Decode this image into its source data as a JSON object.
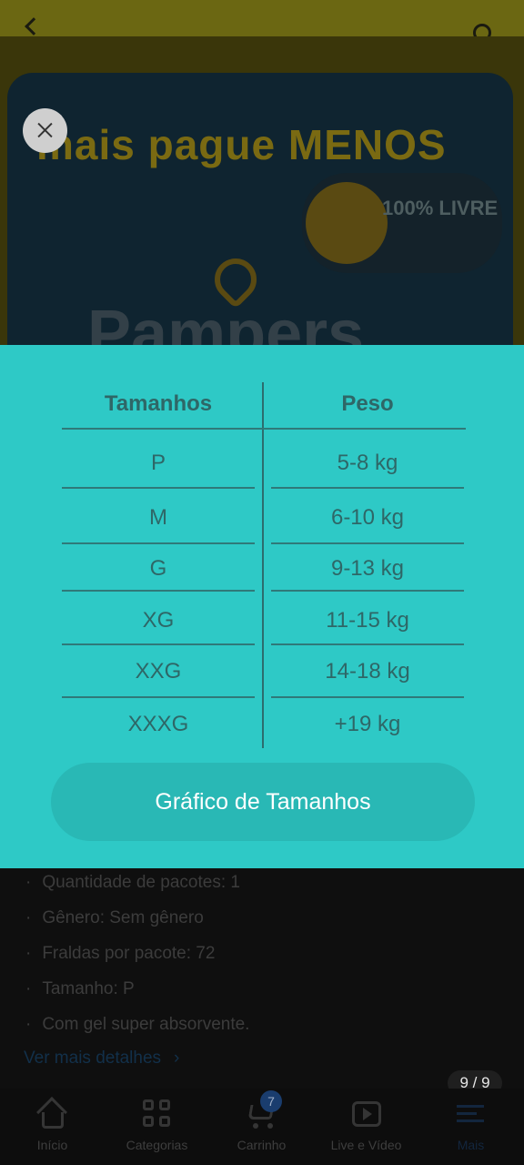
{
  "header": {
    "back_icon": "arrow-left-icon",
    "search_icon": "search-icon"
  },
  "product_image": {
    "banner": "mais pague MENOS",
    "badge": "100% LIVRE",
    "brand": "Pampers"
  },
  "size_chart": {
    "columns": [
      "Tamanhos",
      "Peso"
    ],
    "rows": [
      {
        "size": "P",
        "weight": "5-8 kg"
      },
      {
        "size": "M",
        "weight": "6-10 kg"
      },
      {
        "size": "G",
        "weight": "9-13 kg"
      },
      {
        "size": "XG",
        "weight": "11-15 kg"
      },
      {
        "size": "XXG",
        "weight": "14-18 kg"
      },
      {
        "size": "XXXG",
        "weight": "+19 kg"
      }
    ],
    "button_label": "Gráfico de Tamanhos"
  },
  "image_counter": "9 / 9",
  "details": {
    "items": [
      "Quantidade de pacotes: 1",
      "Gênero: Sem gênero",
      "Fraldas por pacote: 72",
      "Tamanho: P",
      "Com gel super absorvente."
    ],
    "see_more": "Ver mais detalhes"
  },
  "bottom_nav": {
    "items": [
      {
        "label": "Início",
        "icon": "home-icon"
      },
      {
        "label": "Categorias",
        "icon": "categories-icon"
      },
      {
        "label": "Carrinho",
        "icon": "cart-icon",
        "badge": "7"
      },
      {
        "label": "Live e Vídeo",
        "icon": "play-icon"
      },
      {
        "label": "Mais",
        "icon": "more-icon"
      }
    ]
  }
}
